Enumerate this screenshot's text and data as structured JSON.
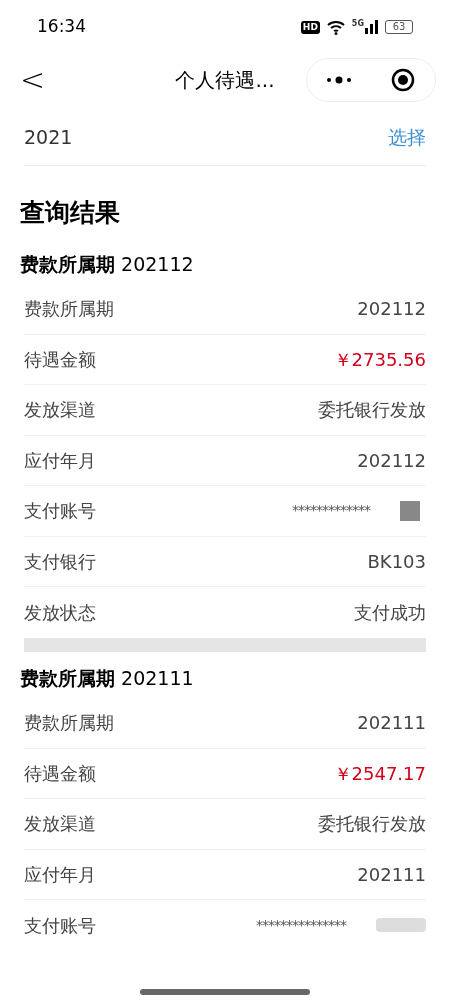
{
  "status_bar": {
    "time": "16:34",
    "hd": "HD",
    "network": "5G",
    "battery": "63"
  },
  "nav": {
    "back": "<",
    "title": "个人待遇..."
  },
  "year_row": {
    "value": "2021",
    "action": "选择"
  },
  "heading": "查询结果",
  "records": [
    {
      "title": "**费款所属期** 202112",
      "rows": [
        {
          "label": "费款所属期",
          "value": "202112",
          "kind": "plain"
        },
        {
          "label": "待遇金额",
          "value": "￥2735.56",
          "kind": "amount"
        },
        {
          "label": "发放渠道",
          "value": "委托银行发放",
          "kind": "plain"
        },
        {
          "label": "应付年月",
          "value": "202112",
          "kind": "plain"
        },
        {
          "label": "支付账号",
          "value": "*************",
          "kind": "masked"
        },
        {
          "label": "支付银行",
          "value": "BK103",
          "kind": "plain"
        },
        {
          "label": "发放状态",
          "value": "支付成功",
          "kind": "plain"
        }
      ]
    },
    {
      "title": "**费款所属期** 202111",
      "rows": [
        {
          "label": "费款所属期",
          "value": "202111",
          "kind": "plain"
        },
        {
          "label": "待遇金额",
          "value": "￥2547.17",
          "kind": "amount"
        },
        {
          "label": "发放渠道",
          "value": "委托银行发放",
          "kind": "plain"
        },
        {
          "label": "应付年月",
          "value": "202111",
          "kind": "plain"
        },
        {
          "label": "支付账号",
          "value": "***************",
          "kind": "masked"
        }
      ]
    }
  ]
}
